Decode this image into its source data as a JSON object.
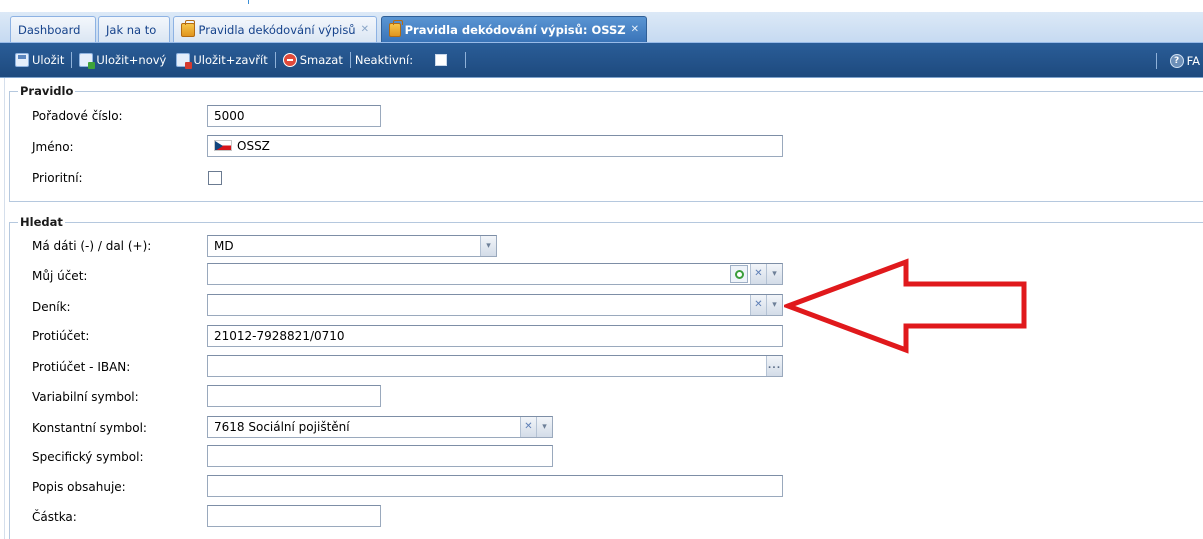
{
  "tabs": [
    {
      "label": "Dashboard",
      "active": false,
      "closable": false
    },
    {
      "label": "Jak na to",
      "active": false,
      "closable": false
    },
    {
      "label": "Pravidla dekódování výpisů",
      "active": false,
      "closable": true,
      "icon": "folder-icon"
    },
    {
      "label": "Pravidla dekódování výpisů: OSSZ",
      "active": true,
      "closable": true,
      "icon": "folder-icon"
    }
  ],
  "tab_close_glyph": "✕",
  "toolbar": {
    "save_label": "Uložit",
    "save_new_label": "Uložit+nový",
    "save_close_label": "Uložit+zavřít",
    "delete_label": "Smazat",
    "inactive_label": "Neaktivní:",
    "inactive_checked": false,
    "help_label": "FA",
    "help_glyph": "?"
  },
  "rule_group": {
    "legend": "Pravidlo",
    "order_label": "Pořadové číslo:",
    "order_value": "5000",
    "name_label": "Jméno:",
    "name_value": "OSSZ",
    "name_flag": "flag-cz-icon",
    "priority_label": "Prioritní:",
    "priority_checked": false
  },
  "search_group": {
    "legend": "Hledat",
    "md_label": "Má dáti (-) / dal (+):",
    "md_value": "MD",
    "my_account_label": "Můj účet:",
    "my_account_value": "",
    "journal_label": "Deník:",
    "journal_value": "",
    "counter_account_label": "Protiúčet:",
    "counter_account_value": "21012-7928821/0710",
    "counter_iban_label": "Protiúčet - IBAN:",
    "counter_iban_value": "",
    "variable_symbol_label": "Variabilní symbol:",
    "variable_symbol_value": "",
    "constant_symbol_label": "Konstantní symbol:",
    "constant_symbol_value": "7618 Sociální pojištění",
    "specific_symbol_label": "Specifický symbol:",
    "specific_symbol_value": "",
    "description_label": "Popis obsahuje:",
    "description_value": "",
    "amount_label": "Částka:",
    "amount_value": ""
  },
  "glyphs": {
    "dropdown": "▾",
    "clear": "✕",
    "ellipsis": "..."
  },
  "colors": {
    "toolbar_bg": "#1e4a7e",
    "active_tab_bg": "#3a74b8",
    "annotation_arrow": "#e0191c"
  }
}
